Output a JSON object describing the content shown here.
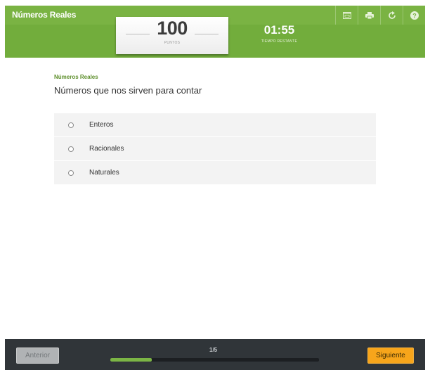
{
  "header": {
    "title": "Números Reales",
    "icons": [
      "window-icon",
      "print-icon",
      "refresh-icon",
      "help-icon"
    ]
  },
  "score": {
    "value": "100",
    "label": "PUNTOS"
  },
  "timer": {
    "value": "01:55",
    "label": "TIEMPO RESTANTE"
  },
  "question": {
    "category": "Números Reales",
    "text": "Números que nos sirven para contar",
    "options": [
      "Enteros",
      "Racionales",
      "Naturales"
    ]
  },
  "footer": {
    "prev_label": "Anterior",
    "next_label": "Siguiente",
    "progress_text": "1/5",
    "progress_fraction": 0.2
  },
  "colors": {
    "brand_green": "#7bb545",
    "footer_dark": "#303539",
    "next_button": "#f7a51b"
  }
}
